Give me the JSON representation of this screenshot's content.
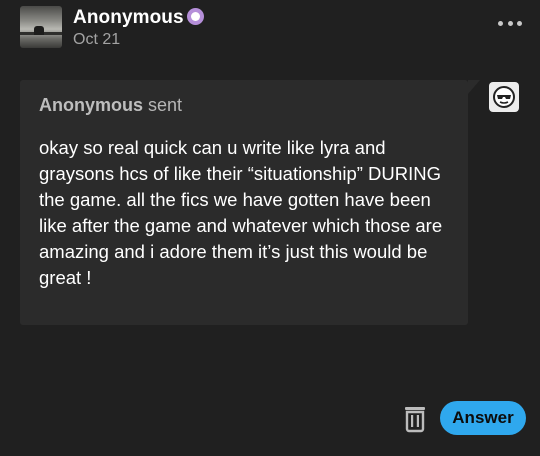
{
  "post": {
    "author_name": "Anonymous",
    "date": "Oct 21",
    "badge_icon": "purple-badge-icon",
    "more_icon": "more-options-icon"
  },
  "ask": {
    "asker_name": "Anonymous",
    "sent_label": "sent",
    "question_text": "okay so real quick can u write like lyra and graysons hcs of like their “situationship” DURING the game. all the fics we have gotten have been like after the game and whatever which those are amazing and i adore them it’s just this would be great !",
    "asker_avatar_icon": "anonymous-sunglasses-icon"
  },
  "actions": {
    "delete_icon": "trash-icon",
    "answer_label": "Answer"
  },
  "colors": {
    "background": "#202020",
    "bubble": "#2b2b2b",
    "accent": "#2fa8ee",
    "badge": "#b58fd9"
  }
}
